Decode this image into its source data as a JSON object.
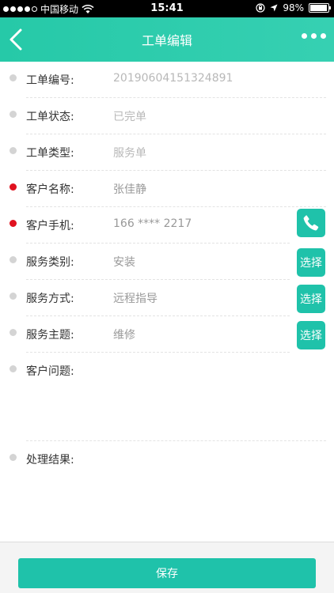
{
  "status_bar": {
    "carrier": "中国移动",
    "time": "15:41",
    "battery": "98%"
  },
  "navbar": {
    "title": "工单编辑",
    "back_icon": "chevron-left-icon",
    "more_icon": "more-horizontal-icon"
  },
  "form": {
    "rows": [
      {
        "label": "工单编号:",
        "value": "20190604151324891",
        "required": false
      },
      {
        "label": "工单状态:",
        "value": "已完单",
        "required": false
      },
      {
        "label": "工单类型:",
        "value": "服务单",
        "required": false
      },
      {
        "label": "客户名称:",
        "value": "张佳静",
        "required": true
      },
      {
        "label": "客户手机:",
        "value": "166 **** 2217",
        "required": true
      },
      {
        "label": "服务类别:",
        "value": "安装",
        "required": false
      },
      {
        "label": "服务方式:",
        "value": "远程指导",
        "required": false
      },
      {
        "label": "服务主题:",
        "value": "维修",
        "required": false
      },
      {
        "label": "客户问题:",
        "value": "",
        "required": false
      },
      {
        "label": "处理结果:",
        "value": "",
        "required": false
      }
    ],
    "select_label": "选择",
    "phone_icon": "phone-icon"
  },
  "footer": {
    "save_label": "保存"
  },
  "colors": {
    "accent": "#1fc2aa",
    "required": "#e0121f"
  }
}
